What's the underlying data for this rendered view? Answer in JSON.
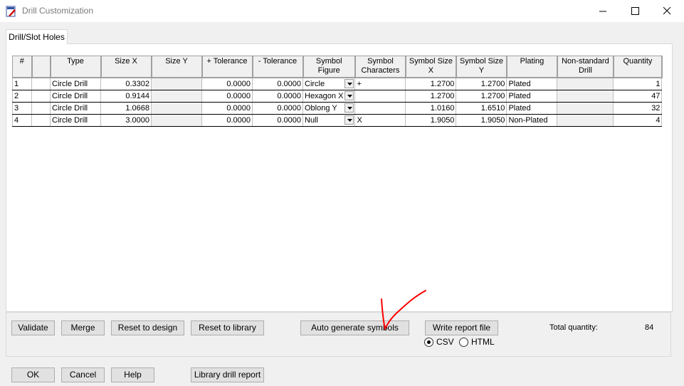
{
  "window": {
    "title": "Drill Customization",
    "icon": "drill-app-icon"
  },
  "tabs": [
    {
      "label": "Drill/Slot Holes",
      "active": true
    }
  ],
  "table": {
    "headers": [
      "#",
      "",
      "Type",
      "Size X",
      "Size Y",
      "+ Tolerance",
      "- Tolerance",
      "Symbol Figure",
      "Symbol Characters",
      "Symbol Size X",
      "Symbol Size Y",
      "Plating",
      "Non-standard Drill",
      "Quantity"
    ],
    "rows": [
      {
        "num": "1",
        "type": "Circle Drill",
        "size_x": "0.3302",
        "size_y": "",
        "plus_tol": "0.0000",
        "minus_tol": "0.0000",
        "symbol_figure": "Circle",
        "symbol_chars": "+",
        "sym_size_x": "1.2700",
        "sym_size_y": "1.2700",
        "plating": "Plated",
        "nonstandard": "",
        "quantity": "1"
      },
      {
        "num": "2",
        "type": "Circle Drill",
        "size_x": "0.9144",
        "size_y": "",
        "plus_tol": "0.0000",
        "minus_tol": "0.0000",
        "symbol_figure": "Hexagon X",
        "symbol_chars": "",
        "sym_size_x": "1.2700",
        "sym_size_y": "1.2700",
        "plating": "Plated",
        "nonstandard": "",
        "quantity": "47"
      },
      {
        "num": "3",
        "type": "Circle Drill",
        "size_x": "1.0668",
        "size_y": "",
        "plus_tol": "0.0000",
        "minus_tol": "0.0000",
        "symbol_figure": "Oblong Y",
        "symbol_chars": "",
        "sym_size_x": "1.0160",
        "sym_size_y": "1.6510",
        "plating": "Plated",
        "nonstandard": "",
        "quantity": "32"
      },
      {
        "num": "4",
        "type": "Circle Drill",
        "size_x": "3.0000",
        "size_y": "",
        "plus_tol": "0.0000",
        "minus_tol": "0.0000",
        "symbol_figure": "Null",
        "symbol_chars": "X",
        "sym_size_x": "1.9050",
        "sym_size_y": "1.9050",
        "plating": "Non-Plated",
        "nonstandard": "",
        "quantity": "4"
      }
    ]
  },
  "actions": {
    "validate": "Validate",
    "merge": "Merge",
    "reset_design": "Reset to design",
    "reset_library": "Reset to library",
    "auto_generate": "Auto generate symbols",
    "write_report": "Write report file"
  },
  "report_format": {
    "options": [
      "CSV",
      "HTML"
    ],
    "selected": "CSV"
  },
  "total": {
    "label": "Total quantity:",
    "value": "84"
  },
  "footer": {
    "ok": "OK",
    "cancel": "Cancel",
    "help": "Help",
    "library_report": "Library drill report"
  },
  "colors": {
    "annotation": "#ff0000",
    "panel": "#ffffff",
    "dialog": "#f0f0f0"
  }
}
